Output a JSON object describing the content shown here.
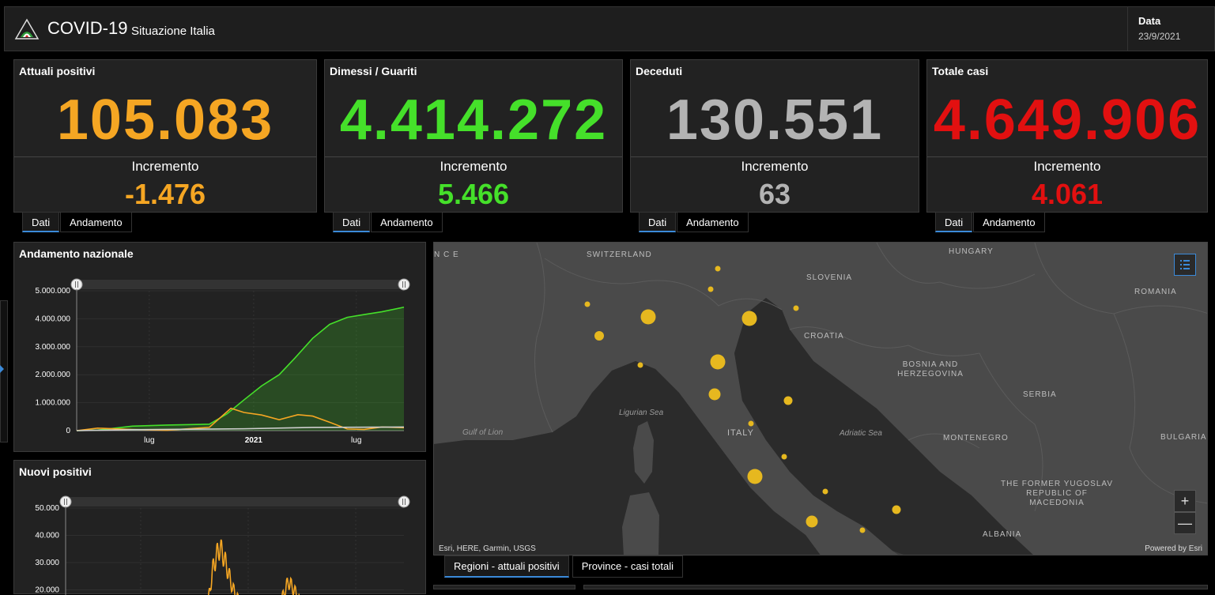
{
  "header": {
    "title": "COVID-19",
    "subtitle": "Situazione Italia",
    "date_label": "Data",
    "date_value": "23/9/2021"
  },
  "cards": [
    {
      "title": "Attuali positivi",
      "value": "105.083",
      "inc_label": "Incremento",
      "inc_value": "-1.476",
      "color": "#f5a623"
    },
    {
      "title": "Dimessi / Guariti",
      "value": "4.414.272",
      "inc_label": "Incremento",
      "inc_value": "5.466",
      "color": "#45e02a"
    },
    {
      "title": "Deceduti",
      "value": "130.551",
      "inc_label": "Incremento",
      "inc_value": "63",
      "color": "#b3b3b3"
    },
    {
      "title": "Totale casi",
      "value": "4.649.906",
      "inc_label": "Incremento",
      "inc_value": "4.061",
      "color": "#e21010"
    }
  ],
  "card_tabs": {
    "dati": "Dati",
    "andamento": "Andamento"
  },
  "charts": {
    "national_title": "Andamento nazionale",
    "new_positives_title": "Nuovi positivi"
  },
  "chart_data": [
    {
      "type": "area",
      "title": "Andamento nazionale",
      "y_ticks": [
        "5.000.000",
        "4.000.000",
        "3.000.000",
        "2.000.000",
        "1.000.000",
        "0"
      ],
      "x_ticks": [
        "lug",
        "2021",
        "lug"
      ],
      "ylim": [
        0,
        5000000
      ],
      "series": [
        {
          "color": "#45e02a",
          "x": [
            "2020-02-24",
            "2020-04-01",
            "2020-06-01",
            "2020-08-01",
            "2020-10-15",
            "2020-11-15",
            "2020-12-15",
            "2021-01-15",
            "2021-02-15",
            "2021-03-15",
            "2021-04-15",
            "2021-05-15",
            "2021-06-15",
            "2021-07-15",
            "2021-08-15",
            "2021-09-23"
          ],
          "values": [
            0,
            20000,
            160000,
            200000,
            230000,
            600000,
            1100000,
            1600000,
            2000000,
            2600000,
            3300000,
            3800000,
            4050000,
            4150000,
            4250000,
            4414272
          ]
        },
        {
          "color": "#f5a623",
          "x": [
            "2020-02-24",
            "2020-04-01",
            "2020-06-01",
            "2020-08-01",
            "2020-10-15",
            "2020-11-22",
            "2020-12-15",
            "2021-01-15",
            "2021-02-15",
            "2021-03-20",
            "2021-04-15",
            "2021-05-15",
            "2021-06-15",
            "2021-07-15",
            "2021-08-15",
            "2021-09-23"
          ],
          "values": [
            0,
            90000,
            40000,
            12000,
            120000,
            800000,
            650000,
            560000,
            390000,
            570000,
            520000,
            300000,
            60000,
            45000,
            130000,
            105083
          ]
        },
        {
          "color": "#cfcfcf",
          "x": [
            "2020-02-24",
            "2020-06-01",
            "2020-12-15",
            "2021-04-15",
            "2021-09-23"
          ],
          "values": [
            0,
            33000,
            67000,
            115000,
            130551
          ]
        }
      ]
    },
    {
      "type": "line",
      "title": "Nuovi positivi",
      "y_ticks": [
        "50.000",
        "40.000",
        "30.000",
        "20.000"
      ],
      "ylim": [
        10000,
        50000
      ],
      "series": [
        {
          "color": "#f5a623",
          "x": [
            "2020-10-15",
            "2020-10-25",
            "2020-11-01",
            "2020-11-08",
            "2020-11-13",
            "2020-11-20",
            "2020-11-27",
            "2020-12-05",
            "2020-12-15",
            "2021-01-05",
            "2021-02-15",
            "2021-03-01",
            "2021-03-10",
            "2021-03-18",
            "2021-03-25",
            "2021-04-05"
          ],
          "values": [
            10000,
            19000,
            31000,
            37000,
            40000,
            36000,
            30000,
            23000,
            18000,
            15000,
            14000,
            20000,
            26000,
            23000,
            20000,
            14000
          ]
        }
      ]
    }
  ],
  "map": {
    "labels": {
      "switzerland": "SWITZERLAND",
      "hungary": "HUNGARY",
      "slovenia": "SLOVENIA",
      "romania": "ROMANIA",
      "croatia": "CROATIA",
      "bosnia": "BOSNIA AND HERZEGOVINA",
      "serbia": "SERBIA",
      "italy": "ITALY",
      "montenegro": "MONTENEGRO",
      "bulgaria": "BULGARIA",
      "macedonia": "THE FORMER YUGOSLAV REPUBLIC OF MACEDONIA",
      "albania": "ALBANIA",
      "france": "N C E"
    },
    "seas": {
      "ligurian": "Ligurian Sea",
      "lion": "Gulf of Lion",
      "adriatic": "Adriatic Sea"
    },
    "attribution_left": "Esri, HERE, Garmin, USGS",
    "attribution_right": "Powered by Esri",
    "zoom_in": "+",
    "zoom_out": "—",
    "dot_color": "#e6b81f"
  },
  "bottom_tabs": {
    "regioni": "Regioni - attuali positivi",
    "province": "Province - casi totali"
  }
}
